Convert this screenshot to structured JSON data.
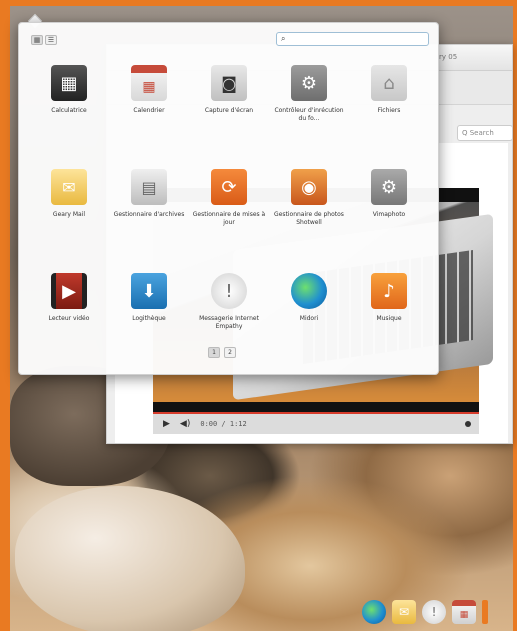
{
  "launcher": {
    "view_toggle": {
      "grid_label": "▦",
      "list_label": "☰"
    },
    "search": {
      "value": "",
      "placeholder": ""
    },
    "apps": [
      {
        "name": "calculatrice",
        "label": "Calculatrice",
        "icon": "calculator-icon",
        "glyph": "▦"
      },
      {
        "name": "calendrier",
        "label": "Calendrier",
        "icon": "calendar-icon",
        "glyph": "▦"
      },
      {
        "name": "capture",
        "label": "Capture d'écran",
        "icon": "camera-icon",
        "glyph": "◙"
      },
      {
        "name": "controleur",
        "label": "Contrôleur d'inrécution du fo...",
        "icon": "gear-icon",
        "glyph": "⚙"
      },
      {
        "name": "fichiers",
        "label": "Fichiers",
        "icon": "home-folder-icon",
        "glyph": "⌂"
      },
      {
        "name": "geary",
        "label": "Geary Mail",
        "icon": "mail-icon",
        "glyph": "✉"
      },
      {
        "name": "archiveur",
        "label": "Gestionnaire d'archives",
        "icon": "archive-icon",
        "glyph": "▤"
      },
      {
        "name": "mises-a-jour",
        "label": "Gestionnaire de mises à jour",
        "icon": "update-icon",
        "glyph": "⟳"
      },
      {
        "name": "shotwell",
        "label": "Gestionnaire de photos Shotwell",
        "icon": "photo-icon",
        "glyph": "◉"
      },
      {
        "name": "vimaphoto",
        "label": "Vimaphoto",
        "icon": "gear-icon",
        "glyph": "⚙"
      },
      {
        "name": "lecteur-video",
        "label": "Lecteur vidéo",
        "icon": "video-player-icon",
        "glyph": "▶"
      },
      {
        "name": "logitheque",
        "label": "Logithèque",
        "icon": "software-center-icon",
        "glyph": "⬇"
      },
      {
        "name": "messagerie",
        "label": "Messagerie Internet Empathy",
        "icon": "chat-icon",
        "glyph": "!"
      },
      {
        "name": "midori",
        "label": "Midori",
        "icon": "web-browser-icon",
        "glyph": ""
      },
      {
        "name": "musique",
        "label": "Musique",
        "icon": "music-icon",
        "glyph": "♪"
      }
    ],
    "pages": [
      "1",
      "2"
    ]
  },
  "browser": {
    "title_fragment": "ry 05",
    "search_placeholder": "Q Search"
  },
  "video_player": {
    "play_glyph": "▶",
    "volume_glyph": "◀)",
    "time": "0:00 / 1:12"
  },
  "dock": [
    {
      "name": "midori",
      "icon": "web-browser-icon",
      "glyph": ""
    },
    {
      "name": "geary",
      "icon": "mail-icon",
      "glyph": "✉"
    },
    {
      "name": "empathy",
      "icon": "chat-icon",
      "glyph": "!"
    },
    {
      "name": "calendrier",
      "icon": "calendar-icon",
      "glyph": "▦"
    }
  ]
}
